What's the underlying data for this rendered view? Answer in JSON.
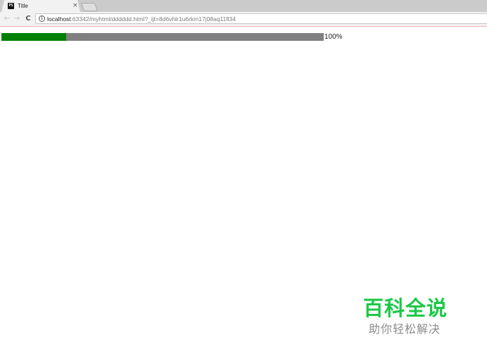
{
  "tab": {
    "favicon_text": "PS",
    "title": "Title",
    "close_symbol": "×"
  },
  "toolbar": {
    "back_symbol": "←",
    "forward_symbol": "→",
    "reload_symbol": "C",
    "info_symbol": "i"
  },
  "address_bar": {
    "host": "localhost",
    "path": ":63342/myhtml/dddddd.html?_ijt=8d6vhlr1u6rkm17j08aq11fl34"
  },
  "progress": {
    "fraction": 0.2,
    "fill_color": "#008000",
    "track_color": "#808080",
    "label": "100%"
  },
  "watermark": {
    "title": "百科全说",
    "subtitle": "助你轻松解决",
    "title_color": "#1bc848"
  }
}
